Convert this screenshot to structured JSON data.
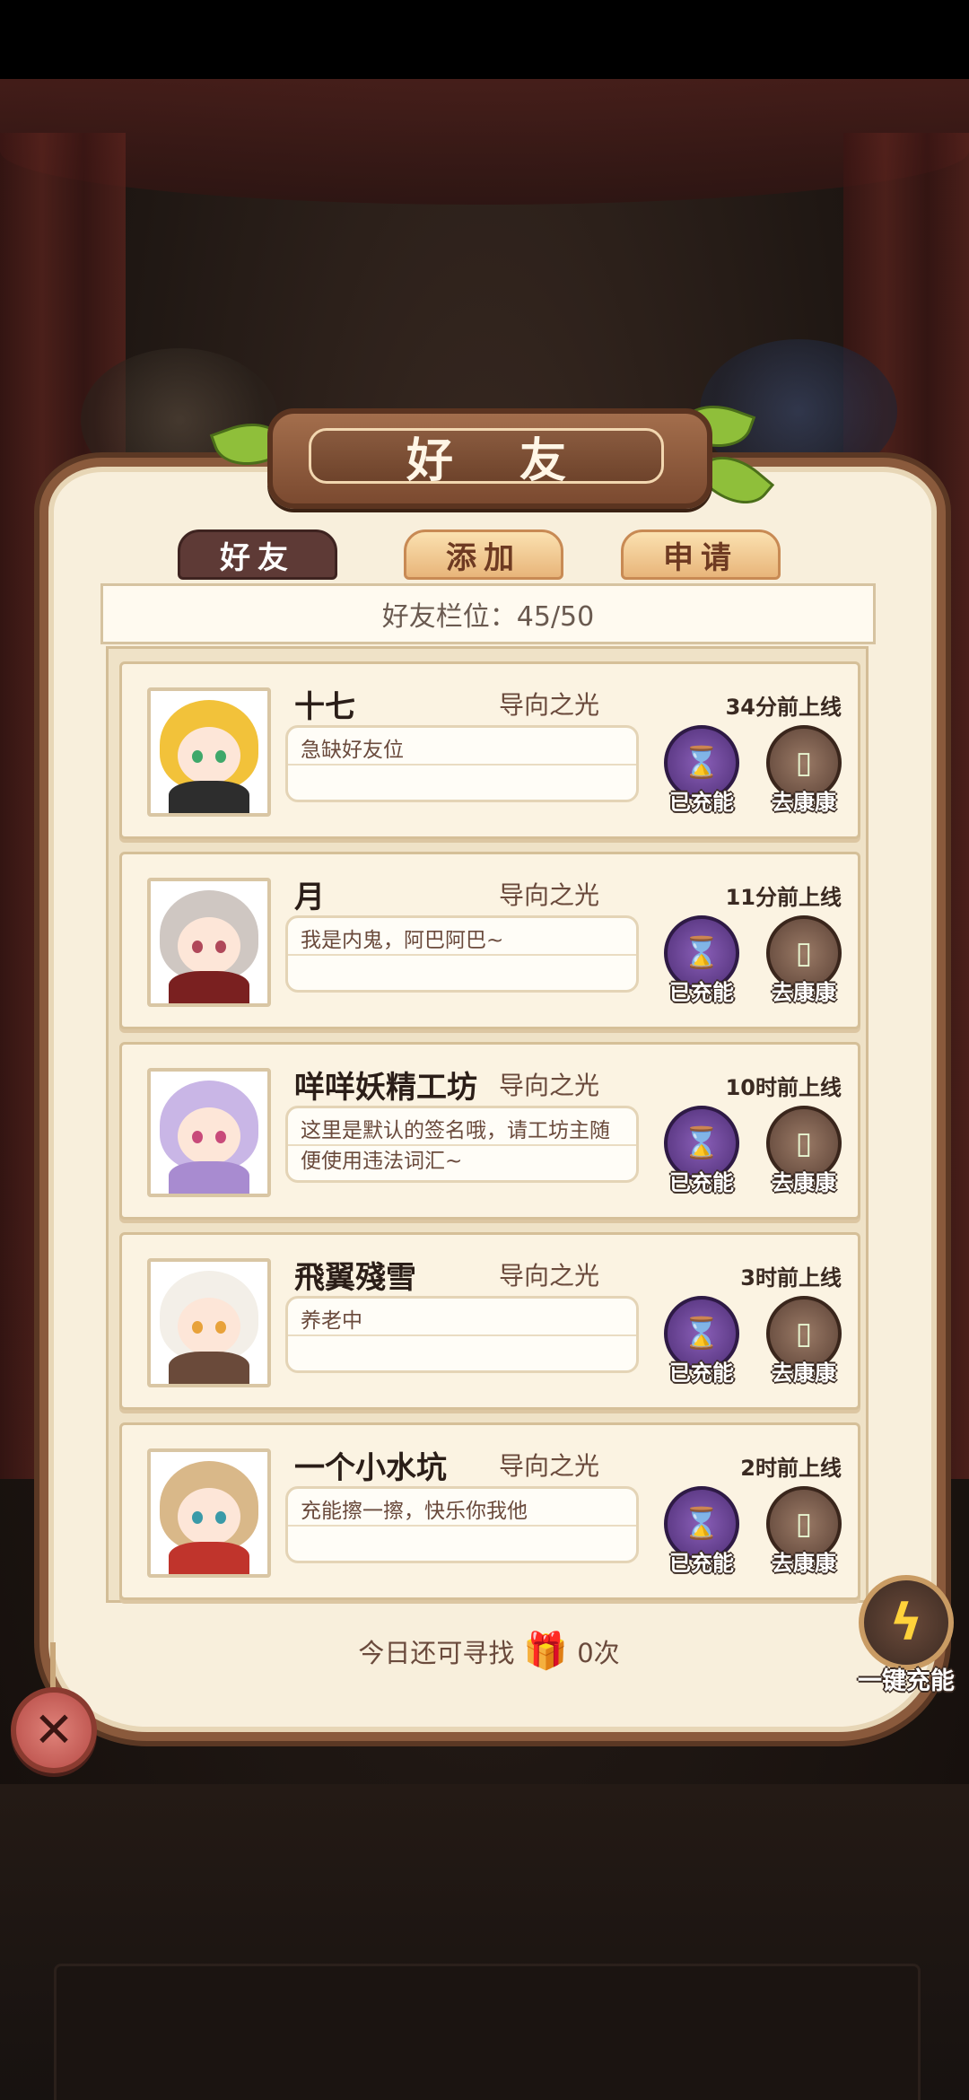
{
  "header": {
    "title": "好 友"
  },
  "tabs": [
    {
      "label": "好友",
      "active": true
    },
    {
      "label": "添加",
      "active": false
    },
    {
      "label": "申请",
      "active": false
    }
  ],
  "slots": {
    "text": "好友栏位：45/50"
  },
  "friends": [
    {
      "name": "十七",
      "guild": "导向之光",
      "online": "34分前上线",
      "signature": "急缺好友位",
      "charge_label": "已充能",
      "visit_label": "去康康",
      "avatar_colors": {
        "hair": "#f2c23a",
        "eye": "#3fa86a",
        "body": "#2d2d2d"
      }
    },
    {
      "name": "月",
      "guild": "导向之光",
      "online": "11分前上线",
      "signature": "我是内鬼，阿巴阿巴~",
      "charge_label": "已充能",
      "visit_label": "去康康",
      "avatar_colors": {
        "hair": "#cfc7c2",
        "eye": "#b0485a",
        "body": "#7a2020"
      }
    },
    {
      "name": "咩咩妖精工坊",
      "guild": "导向之光",
      "online": "10时前上线",
      "signature": "这里是默认的签名哦，请工坊主随便使用违法词汇~",
      "charge_label": "已充能",
      "visit_label": "去康康",
      "avatar_colors": {
        "hair": "#c9b6e6",
        "eye": "#c84a7a",
        "body": "#a88bd0"
      }
    },
    {
      "name": "飛翼殘雪",
      "guild": "导向之光",
      "online": "3时前上线",
      "signature": "养老中",
      "charge_label": "已充能",
      "visit_label": "去康康",
      "avatar_colors": {
        "hair": "#f3efe8",
        "eye": "#e8a23a",
        "body": "#6a4a3a"
      }
    },
    {
      "name": "一个小水坑",
      "guild": "导向之光",
      "online": "2时前上线",
      "signature": "充能擦一擦，快乐你我他",
      "charge_label": "已充能",
      "visit_label": "去康康",
      "avatar_colors": {
        "hair": "#d9b889",
        "eye": "#3a9aa8",
        "body": "#c0342c"
      }
    }
  ],
  "footer": {
    "prefix": "今日还可寻找",
    "count": "0次"
  },
  "one_key": {
    "label": "一键充能"
  },
  "icons": {
    "close": "close-icon",
    "lightning": "lightning-icon",
    "gift": "gift-icon",
    "hourglass": "hourglass-icon",
    "door": "door-icon"
  }
}
